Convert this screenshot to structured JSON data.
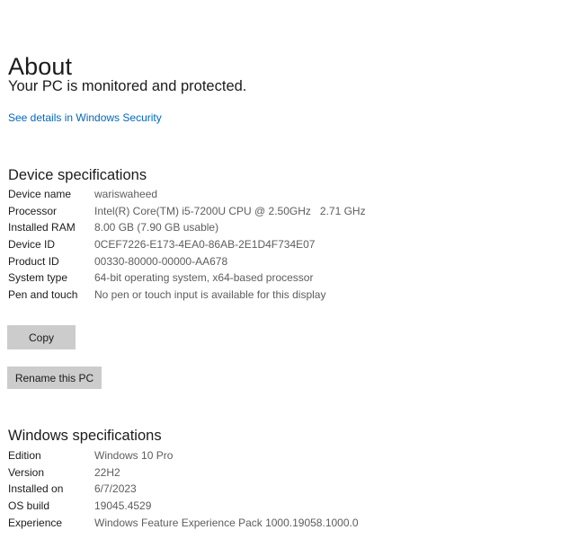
{
  "page": {
    "title": "About",
    "subtitle": "Your PC is monitored and protected.",
    "security_link": "See details in Windows Security"
  },
  "device_specifications": {
    "heading": "Device specifications",
    "rows": [
      {
        "label": "Device name",
        "value": "wariswaheed"
      },
      {
        "label": "Processor",
        "value": "Intel(R) Core(TM) i5-7200U CPU @ 2.50GHz   2.71 GHz"
      },
      {
        "label": "Installed RAM",
        "value": "8.00 GB (7.90 GB usable)"
      },
      {
        "label": "Device ID",
        "value": "0CEF7226-E173-4EA0-86AB-2E1D4F734E07"
      },
      {
        "label": "Product ID",
        "value": "00330-80000-00000-AA678"
      },
      {
        "label": "System type",
        "value": "64-bit operating system, x64-based processor"
      },
      {
        "label": "Pen and touch",
        "value": "No pen or touch input is available for this display"
      }
    ],
    "copy_label": "Copy",
    "rename_label": "Rename this PC"
  },
  "windows_specifications": {
    "heading": "Windows specifications",
    "rows": [
      {
        "label": "Edition",
        "value": "Windows 10 Pro"
      },
      {
        "label": "Version",
        "value": "22H2"
      },
      {
        "label": "Installed on",
        "value": "6/7/2023"
      },
      {
        "label": "OS build",
        "value": "19045.4529"
      },
      {
        "label": "Experience",
        "value": "Windows Feature Experience Pack 1000.19058.1000.0"
      }
    ]
  },
  "colors": {
    "link": "#0067c0",
    "button_face": "#cccccc",
    "label_text": "#1b1b1b",
    "value_text": "#5d5d5d",
    "background": "#ffffff"
  }
}
